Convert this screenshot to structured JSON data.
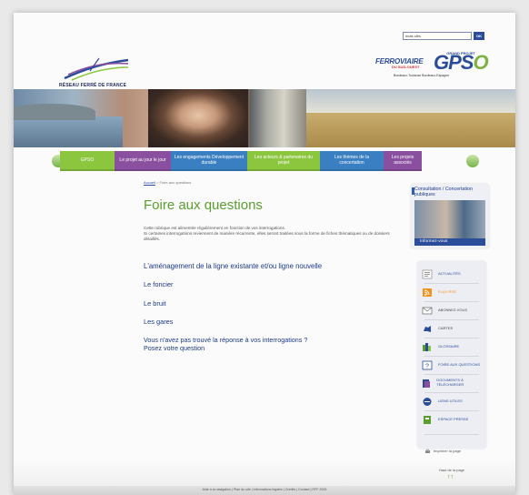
{
  "header": {
    "rff_logo_text": "RÉSEAU FERRÉ DE FRANCE",
    "search_value": "mots clés",
    "search_button": "OK",
    "gpso_small": "GRAND PROJET",
    "gpso_ferroviaire": "FERROVIAIRE",
    "gpso_sud_ouest": "DU SUD-OUEST",
    "gpso_big_gps": "GPS",
    "gpso_big_o": "O",
    "gpso_tagline": "Bordeaux-Toulouse Bordeaux-Espagne"
  },
  "nav": {
    "items": [
      {
        "label": "GPSO",
        "color": "#8cc63f"
      },
      {
        "label": "Le projet au jour le jour",
        "color": "#8a4f9e"
      },
      {
        "label": "Les engagements Développement durable",
        "color": "#3a7fc1"
      },
      {
        "label": "Les acteurs & partenaires du projet",
        "color": "#8cc63f"
      },
      {
        "label": "Les thèmes de la concertation",
        "color": "#3a7fc1"
      },
      {
        "label": "Les projets associés",
        "color": "#8a4f9e"
      }
    ]
  },
  "breadcrumb": {
    "home": "Accueil",
    "separator": ">",
    "current": "Foire aux questions"
  },
  "main": {
    "title": "Foire aux questions",
    "intro_1": "Cette rubrique est alimentée régulièrement en fonction de vos interrogations.",
    "intro_2": "Si certaines interrogations reviennent de manière récurrente, elles seront traitées sous la forme de fiches thématiques ou de dossiers détaillés.",
    "links": [
      "L'aménagement de la ligne existante et/ou ligne nouvelle",
      "Le foncier",
      "Le bruit",
      "Les gares"
    ],
    "question_line1": "Vous n'avez pas trouvé la réponse à vos interrogations ?",
    "question_line2": "Posez votre question"
  },
  "sidebar": {
    "consult_title": "Consultation / Concertation publiques",
    "consult_button": "Informez-vous",
    "tools": [
      {
        "label": "ACTUALITÉS",
        "icon": "newspaper-icon",
        "color": "#888"
      },
      {
        "label": "FLUX RSS",
        "icon": "rss-icon",
        "color": "#f39019"
      },
      {
        "label": "ABONNEZ-VOUS",
        "icon": "envelope-icon",
        "color": "#666"
      },
      {
        "label": "CARTES",
        "icon": "map-icon",
        "color": "#2b4c9a"
      },
      {
        "label": "GLOSSAIRE",
        "icon": "glossary-icon",
        "color": "#5a9e2f"
      },
      {
        "label": "FOIRE AUX QUESTIONS",
        "icon": "question-icon",
        "color": "#2b4c9a"
      },
      {
        "label": "DOCUMENTS À TÉLÉCHARGER",
        "icon": "document-icon",
        "color": "#2b4c9a"
      },
      {
        "label": "LIENS UTILES",
        "icon": "link-icon",
        "color": "#2b4c9a"
      },
      {
        "label": "ESPACE PRESSE",
        "icon": "press-icon",
        "color": "#5a9e2f"
      }
    ],
    "print_label": "Imprimer la page",
    "top_link": "Haut de la page",
    "top_arrow": "↑↑"
  },
  "footer": {
    "links": "Aide à la navigation | Plan du site | Informations légales | Crédits | Contact | RFF 2009"
  }
}
